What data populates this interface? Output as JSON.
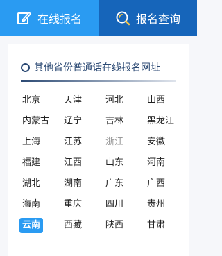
{
  "tabs": {
    "online": {
      "label": "在线报名",
      "icon": "edit-icon"
    },
    "query": {
      "label": "报名查询",
      "icon": "search-icon"
    }
  },
  "section": {
    "title": "其他省份普通话在线报名网址"
  },
  "provinces": [
    {
      "label": "北京",
      "state": "normal"
    },
    {
      "label": "天津",
      "state": "normal"
    },
    {
      "label": "河北",
      "state": "normal"
    },
    {
      "label": "山西",
      "state": "normal"
    },
    {
      "label": "内蒙古",
      "state": "normal"
    },
    {
      "label": "辽宁",
      "state": "normal"
    },
    {
      "label": "吉林",
      "state": "normal"
    },
    {
      "label": "黑龙江",
      "state": "normal"
    },
    {
      "label": "上海",
      "state": "normal"
    },
    {
      "label": "江苏",
      "state": "normal"
    },
    {
      "label": "浙江",
      "state": "muted"
    },
    {
      "label": "安徽",
      "state": "normal"
    },
    {
      "label": "福建",
      "state": "normal"
    },
    {
      "label": "江西",
      "state": "normal"
    },
    {
      "label": "山东",
      "state": "normal"
    },
    {
      "label": "河南",
      "state": "normal"
    },
    {
      "label": "湖北",
      "state": "normal"
    },
    {
      "label": "湖南",
      "state": "normal"
    },
    {
      "label": "广东",
      "state": "normal"
    },
    {
      "label": "广西",
      "state": "normal"
    },
    {
      "label": "海南",
      "state": "normal"
    },
    {
      "label": "重庆",
      "state": "normal"
    },
    {
      "label": "四川",
      "state": "normal"
    },
    {
      "label": "贵州",
      "state": "normal"
    },
    {
      "label": "云南",
      "state": "active"
    },
    {
      "label": "西藏",
      "state": "normal"
    },
    {
      "label": "陕西",
      "state": "normal"
    },
    {
      "label": "甘肃",
      "state": "normal"
    }
  ],
  "colors": {
    "tab_active": "#2a9bf2",
    "tab_inactive": "#1665ba",
    "section_accent": "#2c4a74",
    "active_province": "#2a9bf2",
    "muted_text": "#9a9a9a"
  }
}
